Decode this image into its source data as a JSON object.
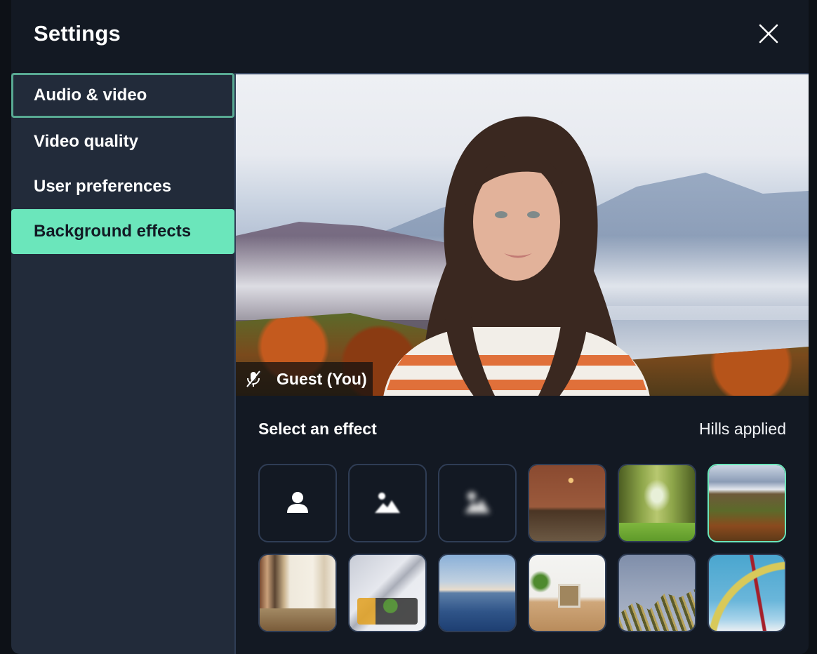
{
  "dialog": {
    "title": "Settings",
    "close_icon": "close-icon"
  },
  "sidebar": {
    "items": [
      {
        "label": "Audio & video",
        "state": "focused"
      },
      {
        "label": "Video quality",
        "state": "default"
      },
      {
        "label": "User preferences",
        "state": "default"
      },
      {
        "label": "Background effects",
        "state": "active"
      }
    ]
  },
  "preview": {
    "participant_name": "Guest (You)",
    "mic_icon": "microphone-off-icon",
    "background": "Hills"
  },
  "effects": {
    "title": "Select an effect",
    "status": "Hills applied",
    "tiles": [
      {
        "name": "None",
        "kind": "icon",
        "icon": "person-icon"
      },
      {
        "name": "Blur slight",
        "kind": "icon",
        "icon": "image-blur-light-icon"
      },
      {
        "name": "Blur strong",
        "kind": "icon",
        "icon": "image-blur-strong-icon"
      },
      {
        "name": "Brick wall",
        "kind": "image"
      },
      {
        "name": "Trees",
        "kind": "image"
      },
      {
        "name": "Hills",
        "kind": "image",
        "selected": true
      },
      {
        "name": "Library",
        "kind": "image"
      },
      {
        "name": "Lounge",
        "kind": "image"
      },
      {
        "name": "Ocean",
        "kind": "image"
      },
      {
        "name": "Bright room",
        "kind": "image"
      },
      {
        "name": "Palm",
        "kind": "image"
      },
      {
        "name": "Roller coaster",
        "kind": "image"
      }
    ]
  },
  "colors": {
    "accent": "#6be6bb",
    "focus_ring": "#58a992",
    "sidebar_bg": "#222b3a",
    "main_bg": "#131923",
    "tile_border": "#2f3d55"
  }
}
